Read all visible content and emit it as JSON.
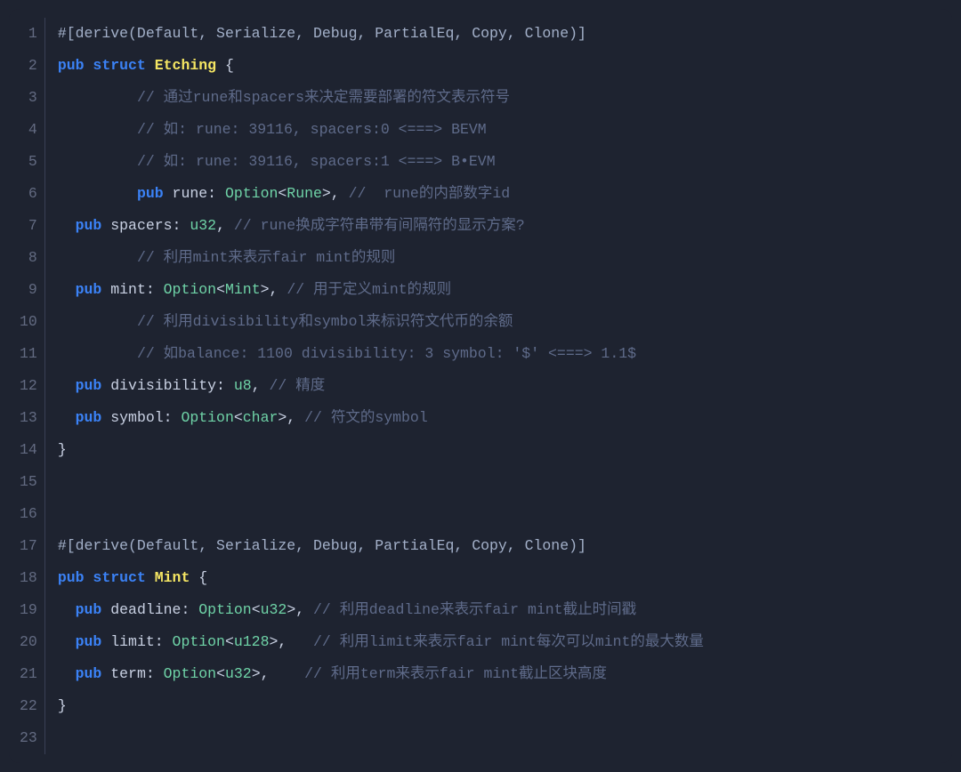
{
  "language": "rust",
  "lines": [
    {
      "n": 1,
      "tokens": [
        {
          "cls": "tok-attr",
          "t": "#[derive(Default, Serialize, Debug, PartialEq, Copy, Clone)]"
        }
      ]
    },
    {
      "n": 2,
      "tokens": [
        {
          "cls": "tok-kw",
          "t": "pub "
        },
        {
          "cls": "tok-kw",
          "t": "struct "
        },
        {
          "cls": "tok-ident",
          "t": "Etching"
        },
        {
          "cls": "tok-punct",
          "t": " {"
        }
      ]
    },
    {
      "n": 3,
      "tokens": [
        {
          "cls": "tok-text",
          "t": "         "
        },
        {
          "cls": "tok-comment",
          "t": "// 通过rune和spacers来决定需要部署的符文表示符号"
        }
      ]
    },
    {
      "n": 4,
      "tokens": [
        {
          "cls": "tok-text",
          "t": "         "
        },
        {
          "cls": "tok-comment",
          "t": "// 如: rune: 39116, spacers:0 <===> BEVM"
        }
      ]
    },
    {
      "n": 5,
      "tokens": [
        {
          "cls": "tok-text",
          "t": "         "
        },
        {
          "cls": "tok-comment",
          "t": "// 如: rune: 39116, spacers:1 <===> B•EVM"
        }
      ]
    },
    {
      "n": 6,
      "tokens": [
        {
          "cls": "tok-text",
          "t": "         "
        },
        {
          "cls": "tok-kw",
          "t": "pub "
        },
        {
          "cls": "tok-text",
          "t": "rune: "
        },
        {
          "cls": "tok-type",
          "t": "Option"
        },
        {
          "cls": "tok-punct",
          "t": "<"
        },
        {
          "cls": "tok-type",
          "t": "Rune"
        },
        {
          "cls": "tok-punct",
          "t": ">, "
        },
        {
          "cls": "tok-comment",
          "t": "//  rune的内部数字id"
        }
      ]
    },
    {
      "n": 7,
      "tokens": [
        {
          "cls": "tok-text",
          "t": "  "
        },
        {
          "cls": "tok-kw",
          "t": "pub "
        },
        {
          "cls": "tok-text",
          "t": "spacers: "
        },
        {
          "cls": "tok-type",
          "t": "u32"
        },
        {
          "cls": "tok-punct",
          "t": ", "
        },
        {
          "cls": "tok-comment",
          "t": "// rune换成字符串带有间隔符的显示方案?"
        }
      ]
    },
    {
      "n": 8,
      "tokens": [
        {
          "cls": "tok-text",
          "t": "         "
        },
        {
          "cls": "tok-comment",
          "t": "// 利用mint来表示fair mint的规则"
        }
      ]
    },
    {
      "n": 9,
      "tokens": [
        {
          "cls": "tok-text",
          "t": "  "
        },
        {
          "cls": "tok-kw",
          "t": "pub "
        },
        {
          "cls": "tok-text",
          "t": "mint: "
        },
        {
          "cls": "tok-type",
          "t": "Option"
        },
        {
          "cls": "tok-punct",
          "t": "<"
        },
        {
          "cls": "tok-type",
          "t": "Mint"
        },
        {
          "cls": "tok-punct",
          "t": ">, "
        },
        {
          "cls": "tok-comment",
          "t": "// 用于定义mint的规则"
        }
      ]
    },
    {
      "n": 10,
      "tokens": [
        {
          "cls": "tok-text",
          "t": "         "
        },
        {
          "cls": "tok-comment",
          "t": "// 利用divisibility和symbol来标识符文代币的余额"
        }
      ]
    },
    {
      "n": 11,
      "tokens": [
        {
          "cls": "tok-text",
          "t": "         "
        },
        {
          "cls": "tok-comment",
          "t": "// 如balance: 1100 divisibility: 3 symbol: '$' <===> 1.1$"
        }
      ]
    },
    {
      "n": 12,
      "tokens": [
        {
          "cls": "tok-text",
          "t": "  "
        },
        {
          "cls": "tok-kw",
          "t": "pub "
        },
        {
          "cls": "tok-text",
          "t": "divisibility: "
        },
        {
          "cls": "tok-type",
          "t": "u8"
        },
        {
          "cls": "tok-punct",
          "t": ", "
        },
        {
          "cls": "tok-comment",
          "t": "// 精度"
        }
      ]
    },
    {
      "n": 13,
      "tokens": [
        {
          "cls": "tok-text",
          "t": "  "
        },
        {
          "cls": "tok-kw",
          "t": "pub "
        },
        {
          "cls": "tok-text",
          "t": "symbol: "
        },
        {
          "cls": "tok-type",
          "t": "Option"
        },
        {
          "cls": "tok-punct",
          "t": "<"
        },
        {
          "cls": "tok-type",
          "t": "char"
        },
        {
          "cls": "tok-punct",
          "t": ">, "
        },
        {
          "cls": "tok-comment",
          "t": "// 符文的symbol"
        }
      ]
    },
    {
      "n": 14,
      "tokens": [
        {
          "cls": "tok-punct",
          "t": "}"
        }
      ]
    },
    {
      "n": 15,
      "tokens": []
    },
    {
      "n": 16,
      "tokens": []
    },
    {
      "n": 17,
      "tokens": [
        {
          "cls": "tok-attr",
          "t": "#[derive(Default, Serialize, Debug, PartialEq, Copy, Clone)]"
        }
      ]
    },
    {
      "n": 18,
      "tokens": [
        {
          "cls": "tok-kw",
          "t": "pub "
        },
        {
          "cls": "tok-kw",
          "t": "struct "
        },
        {
          "cls": "tok-ident",
          "t": "Mint"
        },
        {
          "cls": "tok-punct",
          "t": " {"
        }
      ]
    },
    {
      "n": 19,
      "tokens": [
        {
          "cls": "tok-text",
          "t": "  "
        },
        {
          "cls": "tok-kw",
          "t": "pub "
        },
        {
          "cls": "tok-text",
          "t": "deadline: "
        },
        {
          "cls": "tok-type",
          "t": "Option"
        },
        {
          "cls": "tok-punct",
          "t": "<"
        },
        {
          "cls": "tok-type",
          "t": "u32"
        },
        {
          "cls": "tok-punct",
          "t": ">, "
        },
        {
          "cls": "tok-comment",
          "t": "// 利用deadline来表示fair mint截止时间戳"
        }
      ]
    },
    {
      "n": 20,
      "tokens": [
        {
          "cls": "tok-text",
          "t": "  "
        },
        {
          "cls": "tok-kw",
          "t": "pub "
        },
        {
          "cls": "tok-text",
          "t": "limit: "
        },
        {
          "cls": "tok-type",
          "t": "Option"
        },
        {
          "cls": "tok-punct",
          "t": "<"
        },
        {
          "cls": "tok-type",
          "t": "u128"
        },
        {
          "cls": "tok-punct",
          "t": ">,   "
        },
        {
          "cls": "tok-comment",
          "t": "// 利用limit来表示fair mint每次可以mint的最大数量"
        }
      ]
    },
    {
      "n": 21,
      "tokens": [
        {
          "cls": "tok-text",
          "t": "  "
        },
        {
          "cls": "tok-kw",
          "t": "pub "
        },
        {
          "cls": "tok-text",
          "t": "term: "
        },
        {
          "cls": "tok-type",
          "t": "Option"
        },
        {
          "cls": "tok-punct",
          "t": "<"
        },
        {
          "cls": "tok-type",
          "t": "u32"
        },
        {
          "cls": "tok-punct",
          "t": ">,    "
        },
        {
          "cls": "tok-comment",
          "t": "// 利用term来表示fair mint截止区块高度"
        }
      ]
    },
    {
      "n": 22,
      "tokens": [
        {
          "cls": "tok-punct",
          "t": "}"
        }
      ]
    },
    {
      "n": 23,
      "tokens": []
    }
  ]
}
